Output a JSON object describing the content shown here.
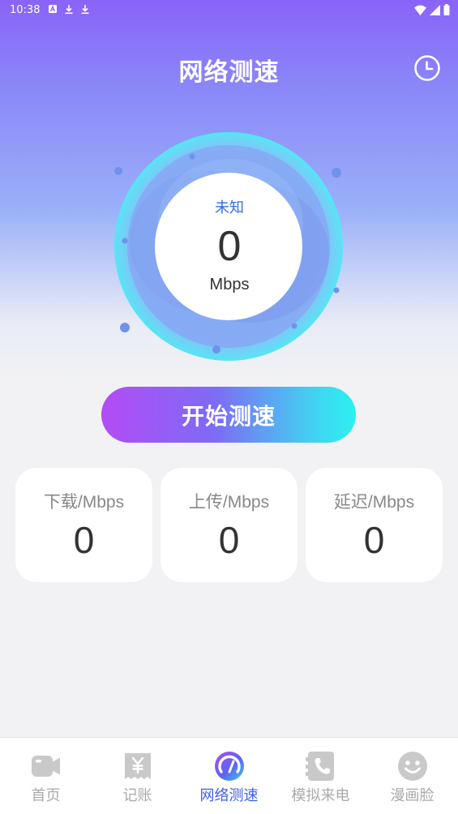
{
  "status_bar": {
    "time": "10:38"
  },
  "header": {
    "title": "网络测速"
  },
  "gauge": {
    "status": "未知",
    "value": "0",
    "unit": "Mbps"
  },
  "actions": {
    "start_label": "开始测速"
  },
  "stats": [
    {
      "label": "下载/Mbps",
      "value": "0"
    },
    {
      "label": "上传/Mbps",
      "value": "0"
    },
    {
      "label": "延迟/Mbps",
      "value": "0"
    }
  ],
  "tabs": [
    {
      "label": "首页",
      "icon": "video-camera-icon"
    },
    {
      "label": "记账",
      "icon": "receipt-yen-icon"
    },
    {
      "label": "网络测速",
      "icon": "speedometer-icon",
      "active": true
    },
    {
      "label": "模拟来电",
      "icon": "phone-call-icon"
    },
    {
      "label": "漫画脸",
      "icon": "smiley-face-icon"
    }
  ],
  "colors": {
    "accent": "#3f61e9",
    "gauge_status": "#2f6ee6",
    "button_start": "#b34cf6",
    "button_end": "#2cf0ef",
    "inactive_tab": "#aaaaaa"
  }
}
